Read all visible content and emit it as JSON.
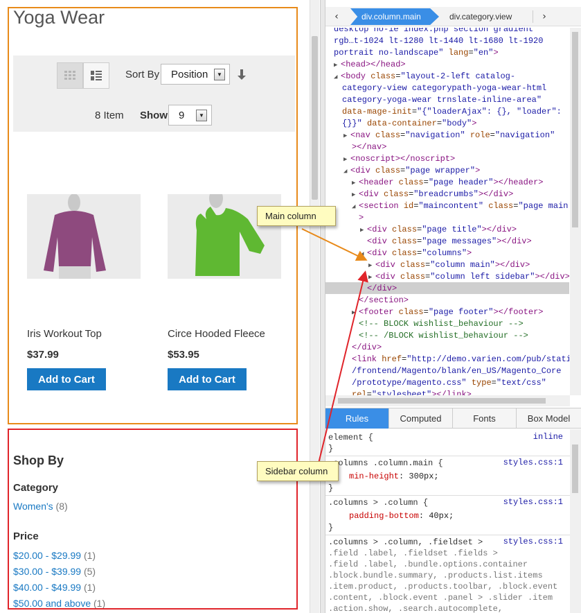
{
  "store": {
    "page_title": "Yoga Wear",
    "toolbar": {
      "sort_label": "Sort By",
      "sort_value": "Position",
      "item_count": "8 Item",
      "show_label": "Show",
      "limit_value": "9",
      "grid_mode_icon": "grid-icon",
      "list_mode_icon": "list-icon",
      "sort_direction_icon": "arrow-down-icon"
    },
    "products": [
      {
        "name": "Iris Workout Top",
        "price": "$37.99",
        "cart_label": "Add to Cart",
        "color": "#8e4a7e"
      },
      {
        "name": "Circe Hooded Fleece",
        "price": "$53.95",
        "cart_label": "Add to Cart",
        "color": "#5fb832"
      }
    ],
    "sidebar": {
      "title": "Shop By",
      "category_title": "Category",
      "categories": [
        {
          "label": "Women's",
          "count": "(8)"
        }
      ],
      "price_title": "Price",
      "prices": [
        {
          "label": "$20.00 - $29.99",
          "count": "(1)"
        },
        {
          "label": "$30.00 - $39.99",
          "count": "(5)"
        },
        {
          "label": "$40.00 - $49.99",
          "count": "(1)"
        },
        {
          "label": "$50.00 and above",
          "count": "(1)"
        }
      ]
    }
  },
  "devtools": {
    "breadcrumb_active": "div.column.main",
    "breadcrumb_next": "div.category.view",
    "tabs": [
      "Rules",
      "Computed",
      "Fonts",
      "Box Model"
    ],
    "active_tab": "Rules",
    "rules": {
      "r1_selector": "element {",
      "r1_source": "inline",
      "r1_close": "}",
      "r2_selector": ".columns .column.main {",
      "r2_source": "styles.css:1",
      "r2_prop": "min-height",
      "r2_val": "300px;",
      "r2_close": "}",
      "r3_selector": ".columns > .column {",
      "r3_source": "styles.css:1",
      "r3_prop": "padding-bottom",
      "r3_val": "40px;",
      "r3_close": "}",
      "r4_source": "styles.css:1",
      "r4_lines": [
        ".columns > .column, .fieldset >",
        ".field .label, .fieldset .fields >",
        ".field .label, .bundle.options.container",
        ".block.bundle.summary, .products.list.items",
        ".item.product, .products.toolbar, .block.event",
        ".content, .block.event .panel > .slider .item",
        ".action.show, .search.autocomplete,"
      ]
    }
  },
  "annotations": {
    "main_callout": "Main column",
    "sidebar_callout": "Sidebar column",
    "main_box_color": "#e88a1a",
    "sidebar_box_color": "#e0242a"
  }
}
